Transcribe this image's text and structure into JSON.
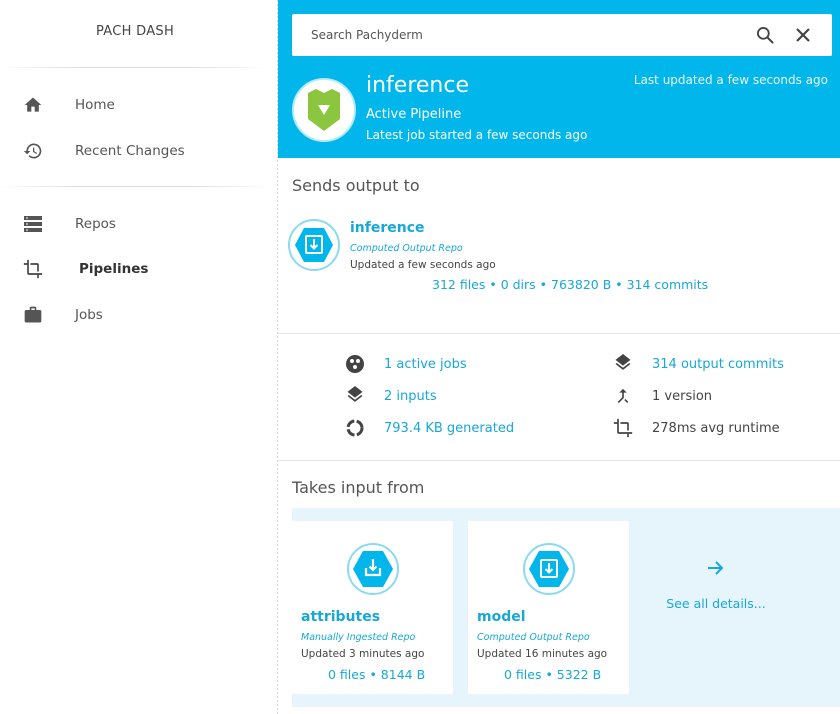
{
  "sidebar": {
    "brand": "PACH DASH",
    "items": [
      {
        "label": "Home",
        "icon": "home-icon"
      },
      {
        "label": "Recent Changes",
        "icon": "history-icon"
      },
      {
        "label": "Repos",
        "icon": "repos-icon"
      },
      {
        "label": "Pipelines",
        "icon": "crop-icon",
        "active": true
      },
      {
        "label": "Jobs",
        "icon": "briefcase-icon"
      }
    ]
  },
  "search": {
    "placeholder": "Search Pachyderm"
  },
  "pipeline": {
    "name": "inference",
    "status": "Active Pipeline",
    "job": "Latest job started a few seconds ago",
    "last_updated": "Last updated a few seconds ago"
  },
  "output": {
    "section_title": "Sends output to",
    "repo_name": "inference",
    "repo_type": "Computed Output Repo",
    "updated": "Updated a few seconds ago",
    "stats": "312 files • 0 dirs • 763820 B • 314 commits"
  },
  "stats": {
    "active_jobs": "1 active jobs",
    "inputs": "2 inputs",
    "generated": "793.4 KB generated",
    "output_commits": "314 output commits",
    "version": "1 version",
    "runtime": "278ms avg runtime"
  },
  "inputs": {
    "section_title": "Takes input from",
    "cards": [
      {
        "name": "attributes",
        "type": "Manually Ingested Repo",
        "updated": "Updated 3 minutes ago",
        "stats": "0 files • 8144 B"
      },
      {
        "name": "model",
        "type": "Computed Output Repo",
        "updated": "Updated 16 minutes ago",
        "stats": "0 files • 5322 B"
      }
    ],
    "see_all": "See all details..."
  },
  "colors": {
    "accent": "#00b6ea",
    "link": "#17a8d8",
    "pipeline_badge": "#8cc63f",
    "inputs_bg": "#e6f4fb"
  }
}
